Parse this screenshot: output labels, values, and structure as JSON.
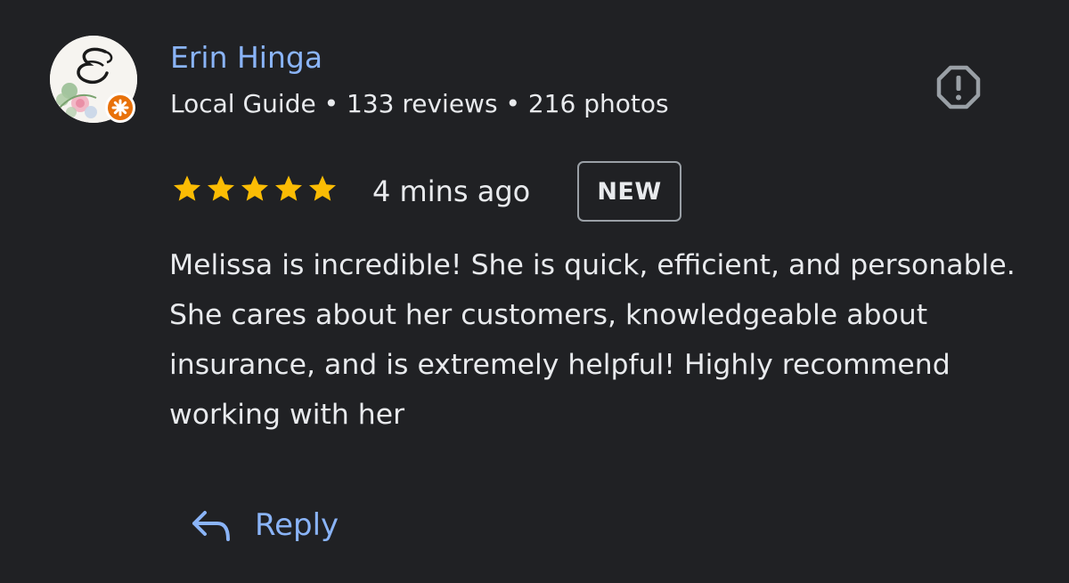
{
  "reviewer": {
    "name": "Erin Hinga",
    "meta": "Local Guide • 133 reviews • 216 photos",
    "avatar_icon": "monogram-avatar-icon",
    "badge_icon": "local-guide-badge-icon"
  },
  "review": {
    "rating": 5,
    "rating_max": 5,
    "time": "4 mins ago",
    "badge": "NEW",
    "text": "Melissa is incredible! She is quick, efficient, and personable. She cares about her customers, knowledgeable about insurance, and is extremely helpful! Highly recommend working with her"
  },
  "actions": {
    "reply_label": "Reply",
    "reply_icon": "reply-arrow-icon",
    "report_icon": "report-icon"
  },
  "colors": {
    "background": "#202124",
    "link": "#8ab4f8",
    "text": "#e8eaed",
    "star": "#fbbc04",
    "badge": "#e8710a"
  }
}
